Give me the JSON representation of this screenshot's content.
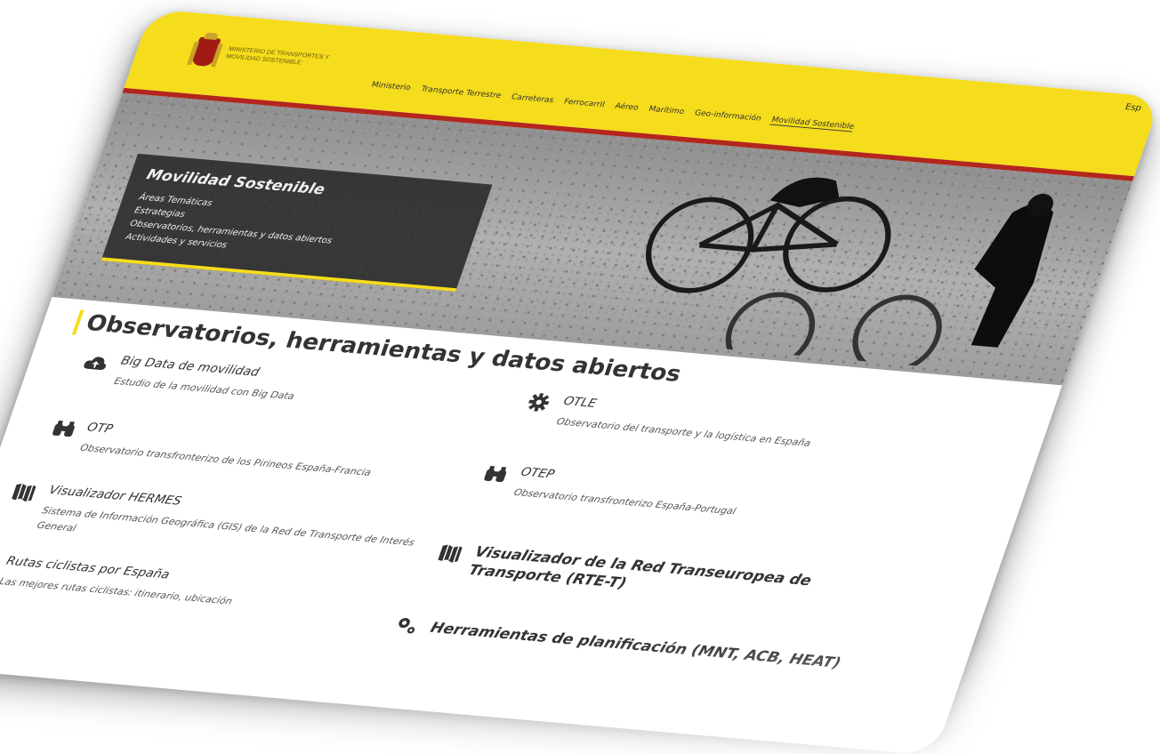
{
  "header": {
    "ministry_text": "MINISTERIO DE TRANSPORTES Y MOVILIDAD SOSTENIBLE",
    "lang": "Esp",
    "nav": [
      {
        "label": "Ministerio"
      },
      {
        "label": "Transporte Terrestre"
      },
      {
        "label": "Carreteras"
      },
      {
        "label": "Ferrocarril"
      },
      {
        "label": "Aéreo"
      },
      {
        "label": "Marítimo"
      },
      {
        "label": "Geo-información"
      },
      {
        "label": "Movilidad Sostenible"
      }
    ]
  },
  "hero": {
    "title": "Movilidad Sostenible",
    "links": [
      "Áreas Temáticas",
      "Estrategias",
      "Observatorios, herramientas y datos abiertos",
      "Actividades y servicios"
    ]
  },
  "main": {
    "heading": "Observatorios, herramientas y datos abiertos",
    "items": [
      {
        "title": "Big Data de movilidad",
        "subtitle": "Estudio de la movilidad con Big Data",
        "icon": "cloud-upload-icon"
      },
      {
        "title": "OTLE",
        "subtitle": "Observatorio del transporte y la logística en España",
        "icon": "gear-icon"
      },
      {
        "title": "OTP",
        "subtitle": "Observatorio transfronterizo de los Pirineos España-Francia",
        "icon": "binoculars-icon"
      },
      {
        "title": "OTEP",
        "subtitle": "Observatorio transfronterizo España-Portugal",
        "icon": "binoculars-icon"
      },
      {
        "title": "Visualizador HERMES",
        "subtitle": "Sistema de Información Geográfica (GIS) de la Red de Transporte de Interés General",
        "icon": "map-icon"
      },
      {
        "title": "Visualizador de la Red Transeuropea de Transporte (RTE-T)",
        "subtitle": "",
        "icon": "map-icon"
      },
      {
        "title": "Rutas ciclistas por España",
        "subtitle": "Las mejores rutas ciclistas: itinerario, ubicación",
        "icon": "map-icon"
      },
      {
        "title": "Herramientas de planificación (MNT, ACB, HEAT)",
        "subtitle": "",
        "icon": "gears-icon"
      }
    ]
  },
  "colors": {
    "header_yellow": "#f5dc1c",
    "accent_red": "#b3261e",
    "hero_box": "#282828"
  }
}
